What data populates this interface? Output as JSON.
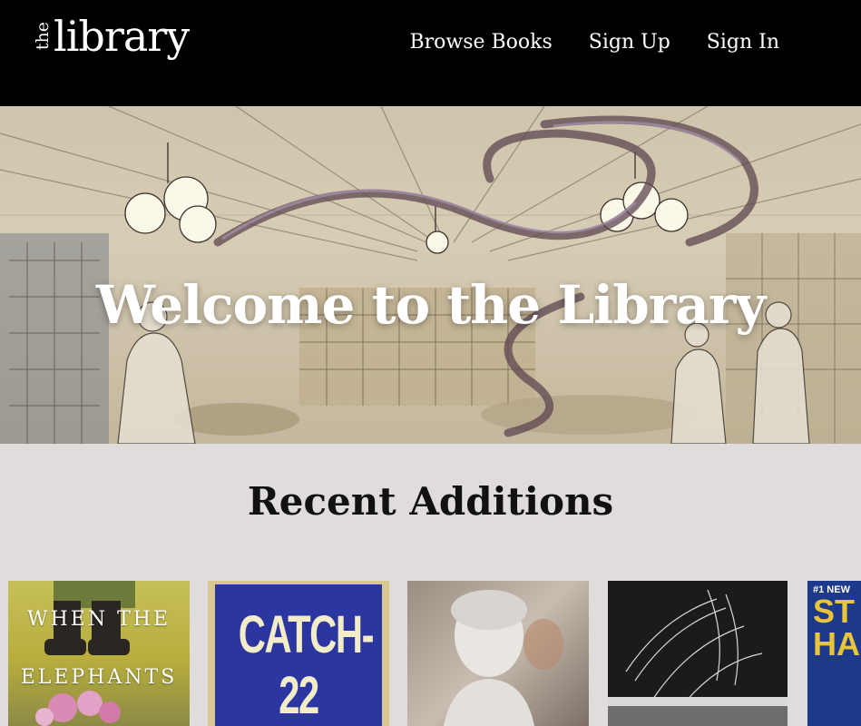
{
  "header": {
    "logo_small": "the",
    "logo_large": "library",
    "nav": [
      {
        "label": "Browse Books"
      },
      {
        "label": "Sign Up"
      },
      {
        "label": "Sign In"
      }
    ]
  },
  "hero": {
    "title": "Welcome to the Library"
  },
  "recent": {
    "heading": "Recent Additions",
    "books": [
      {
        "cover_line1": "WHEN THE",
        "cover_line2": "ELEPHANTS"
      },
      {
        "cover_title": "CATCH-22"
      },
      {
        "cover_title": ""
      },
      {
        "cover_title": ""
      },
      {
        "cover_top": "#1 NEW",
        "cover_title": "ST HA"
      }
    ]
  },
  "colors": {
    "header_bg": "#000000",
    "page_bg": "#e0dcdb",
    "text_light": "#ffffff"
  }
}
